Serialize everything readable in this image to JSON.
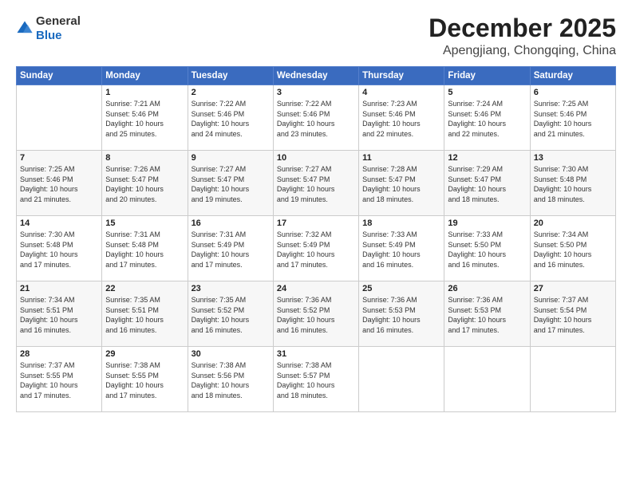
{
  "header": {
    "logo_general": "General",
    "logo_blue": "Blue",
    "month": "December 2025",
    "location": "Apengjiang, Chongqing, China"
  },
  "weekdays": [
    "Sunday",
    "Monday",
    "Tuesday",
    "Wednesday",
    "Thursday",
    "Friday",
    "Saturday"
  ],
  "weeks": [
    [
      {
        "day": "",
        "info": ""
      },
      {
        "day": "1",
        "info": "Sunrise: 7:21 AM\nSunset: 5:46 PM\nDaylight: 10 hours\nand 25 minutes."
      },
      {
        "day": "2",
        "info": "Sunrise: 7:22 AM\nSunset: 5:46 PM\nDaylight: 10 hours\nand 24 minutes."
      },
      {
        "day": "3",
        "info": "Sunrise: 7:22 AM\nSunset: 5:46 PM\nDaylight: 10 hours\nand 23 minutes."
      },
      {
        "day": "4",
        "info": "Sunrise: 7:23 AM\nSunset: 5:46 PM\nDaylight: 10 hours\nand 22 minutes."
      },
      {
        "day": "5",
        "info": "Sunrise: 7:24 AM\nSunset: 5:46 PM\nDaylight: 10 hours\nand 22 minutes."
      },
      {
        "day": "6",
        "info": "Sunrise: 7:25 AM\nSunset: 5:46 PM\nDaylight: 10 hours\nand 21 minutes."
      }
    ],
    [
      {
        "day": "7",
        "info": "Sunrise: 7:25 AM\nSunset: 5:46 PM\nDaylight: 10 hours\nand 21 minutes."
      },
      {
        "day": "8",
        "info": "Sunrise: 7:26 AM\nSunset: 5:47 PM\nDaylight: 10 hours\nand 20 minutes."
      },
      {
        "day": "9",
        "info": "Sunrise: 7:27 AM\nSunset: 5:47 PM\nDaylight: 10 hours\nand 19 minutes."
      },
      {
        "day": "10",
        "info": "Sunrise: 7:27 AM\nSunset: 5:47 PM\nDaylight: 10 hours\nand 19 minutes."
      },
      {
        "day": "11",
        "info": "Sunrise: 7:28 AM\nSunset: 5:47 PM\nDaylight: 10 hours\nand 18 minutes."
      },
      {
        "day": "12",
        "info": "Sunrise: 7:29 AM\nSunset: 5:47 PM\nDaylight: 10 hours\nand 18 minutes."
      },
      {
        "day": "13",
        "info": "Sunrise: 7:30 AM\nSunset: 5:48 PM\nDaylight: 10 hours\nand 18 minutes."
      }
    ],
    [
      {
        "day": "14",
        "info": "Sunrise: 7:30 AM\nSunset: 5:48 PM\nDaylight: 10 hours\nand 17 minutes."
      },
      {
        "day": "15",
        "info": "Sunrise: 7:31 AM\nSunset: 5:48 PM\nDaylight: 10 hours\nand 17 minutes."
      },
      {
        "day": "16",
        "info": "Sunrise: 7:31 AM\nSunset: 5:49 PM\nDaylight: 10 hours\nand 17 minutes."
      },
      {
        "day": "17",
        "info": "Sunrise: 7:32 AM\nSunset: 5:49 PM\nDaylight: 10 hours\nand 17 minutes."
      },
      {
        "day": "18",
        "info": "Sunrise: 7:33 AM\nSunset: 5:49 PM\nDaylight: 10 hours\nand 16 minutes."
      },
      {
        "day": "19",
        "info": "Sunrise: 7:33 AM\nSunset: 5:50 PM\nDaylight: 10 hours\nand 16 minutes."
      },
      {
        "day": "20",
        "info": "Sunrise: 7:34 AM\nSunset: 5:50 PM\nDaylight: 10 hours\nand 16 minutes."
      }
    ],
    [
      {
        "day": "21",
        "info": "Sunrise: 7:34 AM\nSunset: 5:51 PM\nDaylight: 10 hours\nand 16 minutes."
      },
      {
        "day": "22",
        "info": "Sunrise: 7:35 AM\nSunset: 5:51 PM\nDaylight: 10 hours\nand 16 minutes."
      },
      {
        "day": "23",
        "info": "Sunrise: 7:35 AM\nSunset: 5:52 PM\nDaylight: 10 hours\nand 16 minutes."
      },
      {
        "day": "24",
        "info": "Sunrise: 7:36 AM\nSunset: 5:52 PM\nDaylight: 10 hours\nand 16 minutes."
      },
      {
        "day": "25",
        "info": "Sunrise: 7:36 AM\nSunset: 5:53 PM\nDaylight: 10 hours\nand 16 minutes."
      },
      {
        "day": "26",
        "info": "Sunrise: 7:36 AM\nSunset: 5:53 PM\nDaylight: 10 hours\nand 17 minutes."
      },
      {
        "day": "27",
        "info": "Sunrise: 7:37 AM\nSunset: 5:54 PM\nDaylight: 10 hours\nand 17 minutes."
      }
    ],
    [
      {
        "day": "28",
        "info": "Sunrise: 7:37 AM\nSunset: 5:55 PM\nDaylight: 10 hours\nand 17 minutes."
      },
      {
        "day": "29",
        "info": "Sunrise: 7:38 AM\nSunset: 5:55 PM\nDaylight: 10 hours\nand 17 minutes."
      },
      {
        "day": "30",
        "info": "Sunrise: 7:38 AM\nSunset: 5:56 PM\nDaylight: 10 hours\nand 18 minutes."
      },
      {
        "day": "31",
        "info": "Sunrise: 7:38 AM\nSunset: 5:57 PM\nDaylight: 10 hours\nand 18 minutes."
      },
      {
        "day": "",
        "info": ""
      },
      {
        "day": "",
        "info": ""
      },
      {
        "day": "",
        "info": ""
      }
    ]
  ]
}
